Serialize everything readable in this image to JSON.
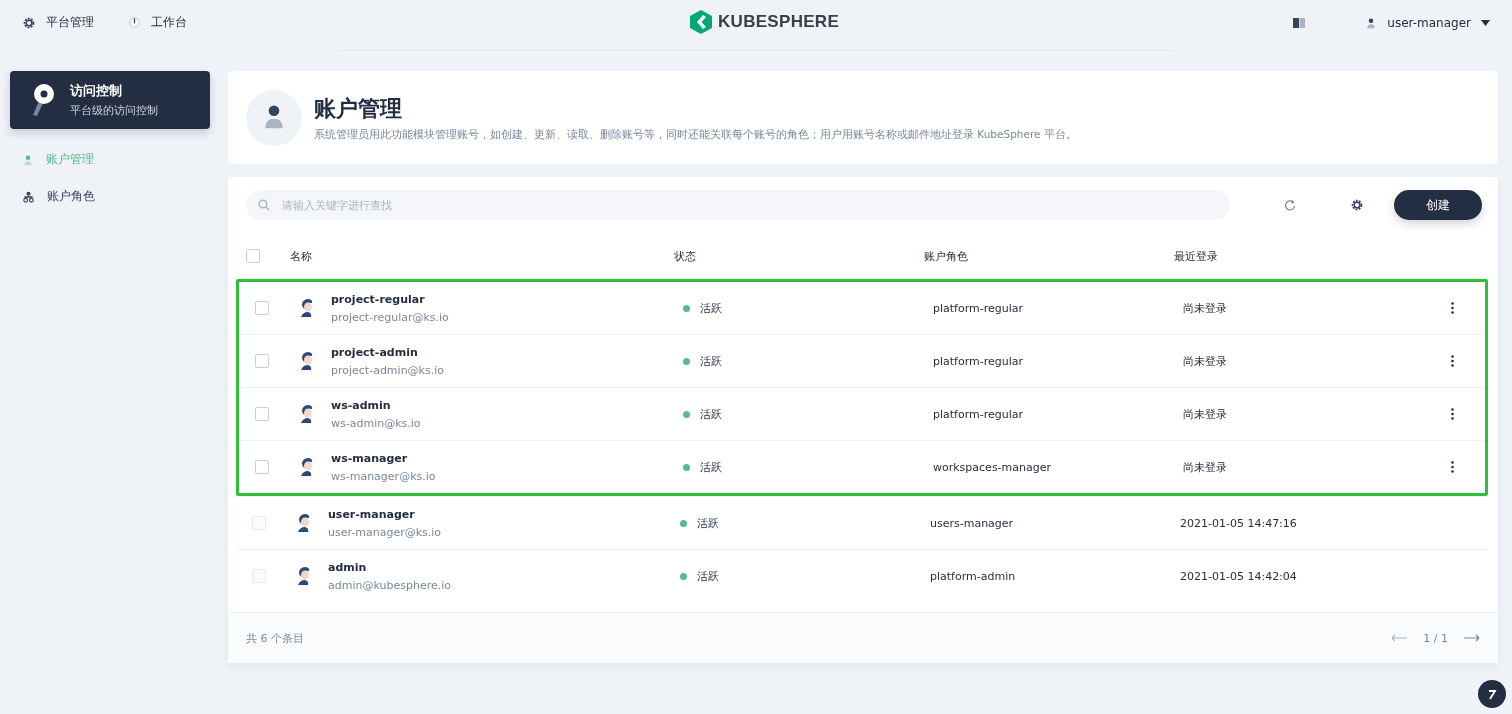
{
  "top_nav": [
    {
      "label": "平台管理",
      "kind": "gear"
    },
    {
      "label": "工作台",
      "kind": "dial"
    }
  ],
  "logo": {
    "text": "KUBESPHERE"
  },
  "user_menu": {
    "name": "user-manager"
  },
  "sidebar": {
    "header": {
      "title": "访问控制",
      "subtitle": "平台级的访问控制"
    },
    "items": [
      {
        "label": "账户管理",
        "kind": "user",
        "selected": true
      },
      {
        "label": "账户角色",
        "kind": "role",
        "selected": false
      }
    ]
  },
  "page_header": {
    "title": "账户管理",
    "description": "系统管理员用此功能模块管理账号，如创建、更新、读取、删除账号等，同时还能关联每个账号的角色；用户用账号名称或邮件地址登录 KubeSphere 平台。"
  },
  "toolbar": {
    "search": {
      "placeholder": "请输入关键字进行查找"
    },
    "create_button": "创建"
  },
  "table": {
    "select_all": {
      "checked": false
    },
    "columns": [
      "名称",
      "状态",
      "账户角色",
      "最近登录"
    ],
    "rows": [
      {
        "name": "project-regular",
        "email": "project-regular@ks.io",
        "status": "活跃",
        "role": "platform-regular",
        "last_login": "尚未登录",
        "disabled": false,
        "highlighted": true
      },
      {
        "name": "project-admin",
        "email": "project-admin@ks.io",
        "status": "活跃",
        "role": "platform-regular",
        "last_login": "尚未登录",
        "disabled": false,
        "highlighted": true
      },
      {
        "name": "ws-admin",
        "email": "ws-admin@ks.io",
        "status": "活跃",
        "role": "platform-regular",
        "last_login": "尚未登录",
        "disabled": false,
        "highlighted": true
      },
      {
        "name": "ws-manager",
        "email": "ws-manager@ks.io",
        "status": "活跃",
        "role": "workspaces-manager",
        "last_login": "尚未登录",
        "disabled": false,
        "highlighted": true
      },
      {
        "name": "user-manager",
        "email": "user-manager@ks.io",
        "status": "活跃",
        "role": "users-manager",
        "last_login": "2021-01-05 14:47:16",
        "disabled": true,
        "highlighted": false
      },
      {
        "name": "admin",
        "email": "admin@kubesphere.io",
        "status": "活跃",
        "role": "platform-admin",
        "last_login": "2021-01-05 14:42:04",
        "disabled": true,
        "highlighted": false
      }
    ]
  },
  "footer": {
    "total": "共 6 个条目",
    "page": "1 / 1"
  }
}
